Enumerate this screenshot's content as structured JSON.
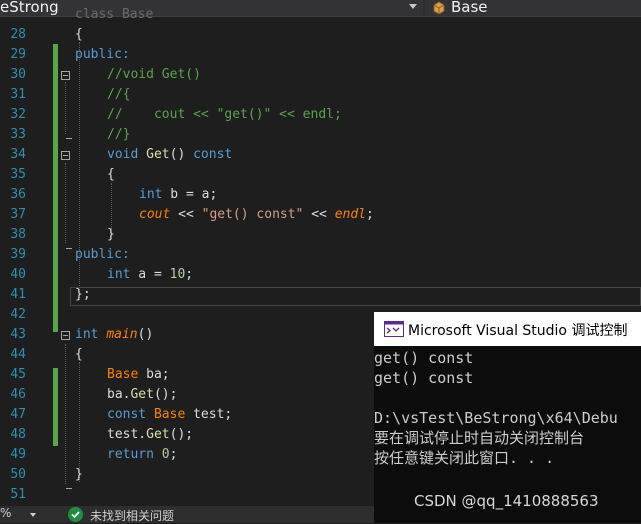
{
  "navbar": {
    "project_label": "eStrong",
    "scope_label": "Base"
  },
  "editor": {
    "line_numbers": [
      "28",
      "29",
      "30",
      "31",
      "32",
      "33",
      "34",
      "35",
      "36",
      "37",
      "38",
      "39",
      "40",
      "41",
      "42",
      "43",
      "44",
      "45",
      "46",
      "47",
      "48",
      "49",
      "50",
      "51"
    ],
    "first_line_text": "class Base",
    "lines": {
      "l28": "{",
      "l29": "public:",
      "l30": "//void Get()",
      "l31": "//{",
      "l32": "//    cout << \"get()\" << endl;",
      "l33": "//}",
      "l34_void": "void",
      "l34_get": "Get",
      "l34_rest": "() ",
      "l34_const": "const",
      "l35": "{",
      "l36_int": "int",
      "l36_rest": " b = a;",
      "l37_cout": "cout",
      "l37_op1": " << ",
      "l37_str": "\"get() const\"",
      "l37_op2": " << ",
      "l37_endl": "endl",
      "l37_semi": ";",
      "l38": "}",
      "l39": "public:",
      "l40_int": "int",
      "l40_rest": " a = ",
      "l40_num": "10",
      "l40_semi": ";",
      "l41": "};",
      "l43_int": "int",
      "l43_sp": " ",
      "l43_main": "main",
      "l43_paren": "()",
      "l44": "{",
      "l45_type": "Base",
      "l45_rest": " ba;",
      "l46_obj": "ba.",
      "l46_fn": "Get",
      "l46_rest": "();",
      "l47_const": "const",
      "l47_sp": " ",
      "l47_type": "Base",
      "l47_rest": " test;",
      "l48_obj": "test.",
      "l48_fn": "Get",
      "l48_rest": "();",
      "l49_ret": "return",
      "l49_rest": " ",
      "l49_num": "0",
      "l49_semi": ";",
      "l50": "}"
    }
  },
  "console": {
    "title": "Microsoft Visual Studio 调试控制",
    "output": [
      "get() const",
      "get() const",
      "",
      "D:\\vsTest\\BeStrong\\x64\\Debu",
      "要在调试停止时自动关闭控制台",
      "按任意键关闭此窗口. . ."
    ],
    "watermark": "CSDN @qq_1410888563"
  },
  "statusbar": {
    "zoom": "%",
    "issues": "未找到相关问题"
  },
  "colors": {
    "keyword": "#569cd6",
    "comment": "#57a64a",
    "function": "#dcdcaa",
    "type": "#4ec9b0",
    "string": "#d69d85",
    "number": "#b5cea8",
    "macro": "#da70d6",
    "accent_green": "#57a64a"
  }
}
